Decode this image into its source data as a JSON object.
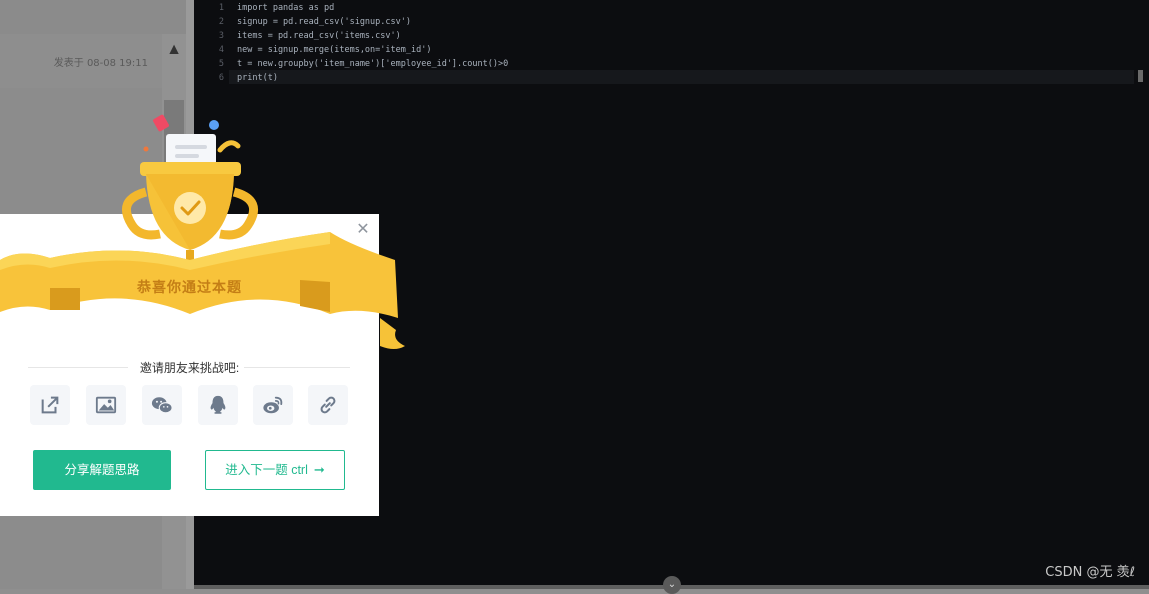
{
  "sidebar": {
    "post_time": "发表于 08-08 19:11",
    "scroll_up_glyph": "▲"
  },
  "editor": {
    "lines": [
      {
        "num": "1",
        "text": "import pandas as pd"
      },
      {
        "num": "2",
        "text": "signup = pd.read_csv('signup.csv')"
      },
      {
        "num": "3",
        "text": "items = pd.read_csv('items.csv')"
      },
      {
        "num": "4",
        "text": "new = signup.merge(items,on='item_id')"
      },
      {
        "num": "5",
        "text": "t = new.groupby('item_name')['employee_id'].count()>0"
      },
      {
        "num": "6",
        "text": "print(t)"
      }
    ],
    "collapse_glyph": "⌄"
  },
  "watermark": "CSDN @无 羡ℓ",
  "modal": {
    "close_glyph": "✕",
    "congrats": "恭喜你通过本题",
    "invite": "邀请朋友来挑战吧:",
    "share_icons": [
      "external-share-icon",
      "image-icon",
      "wechat-icon",
      "qq-icon",
      "weibo-icon",
      "link-icon"
    ],
    "share_solution_label": "分享解题思路",
    "next_label": "进入下一题 ctrl",
    "next_arrow": "➞"
  },
  "colors": {
    "accent": "#21b98f",
    "gold": "#f6c238",
    "ribbon_text": "#c47e16",
    "editor_bg": "#0c0d10"
  }
}
